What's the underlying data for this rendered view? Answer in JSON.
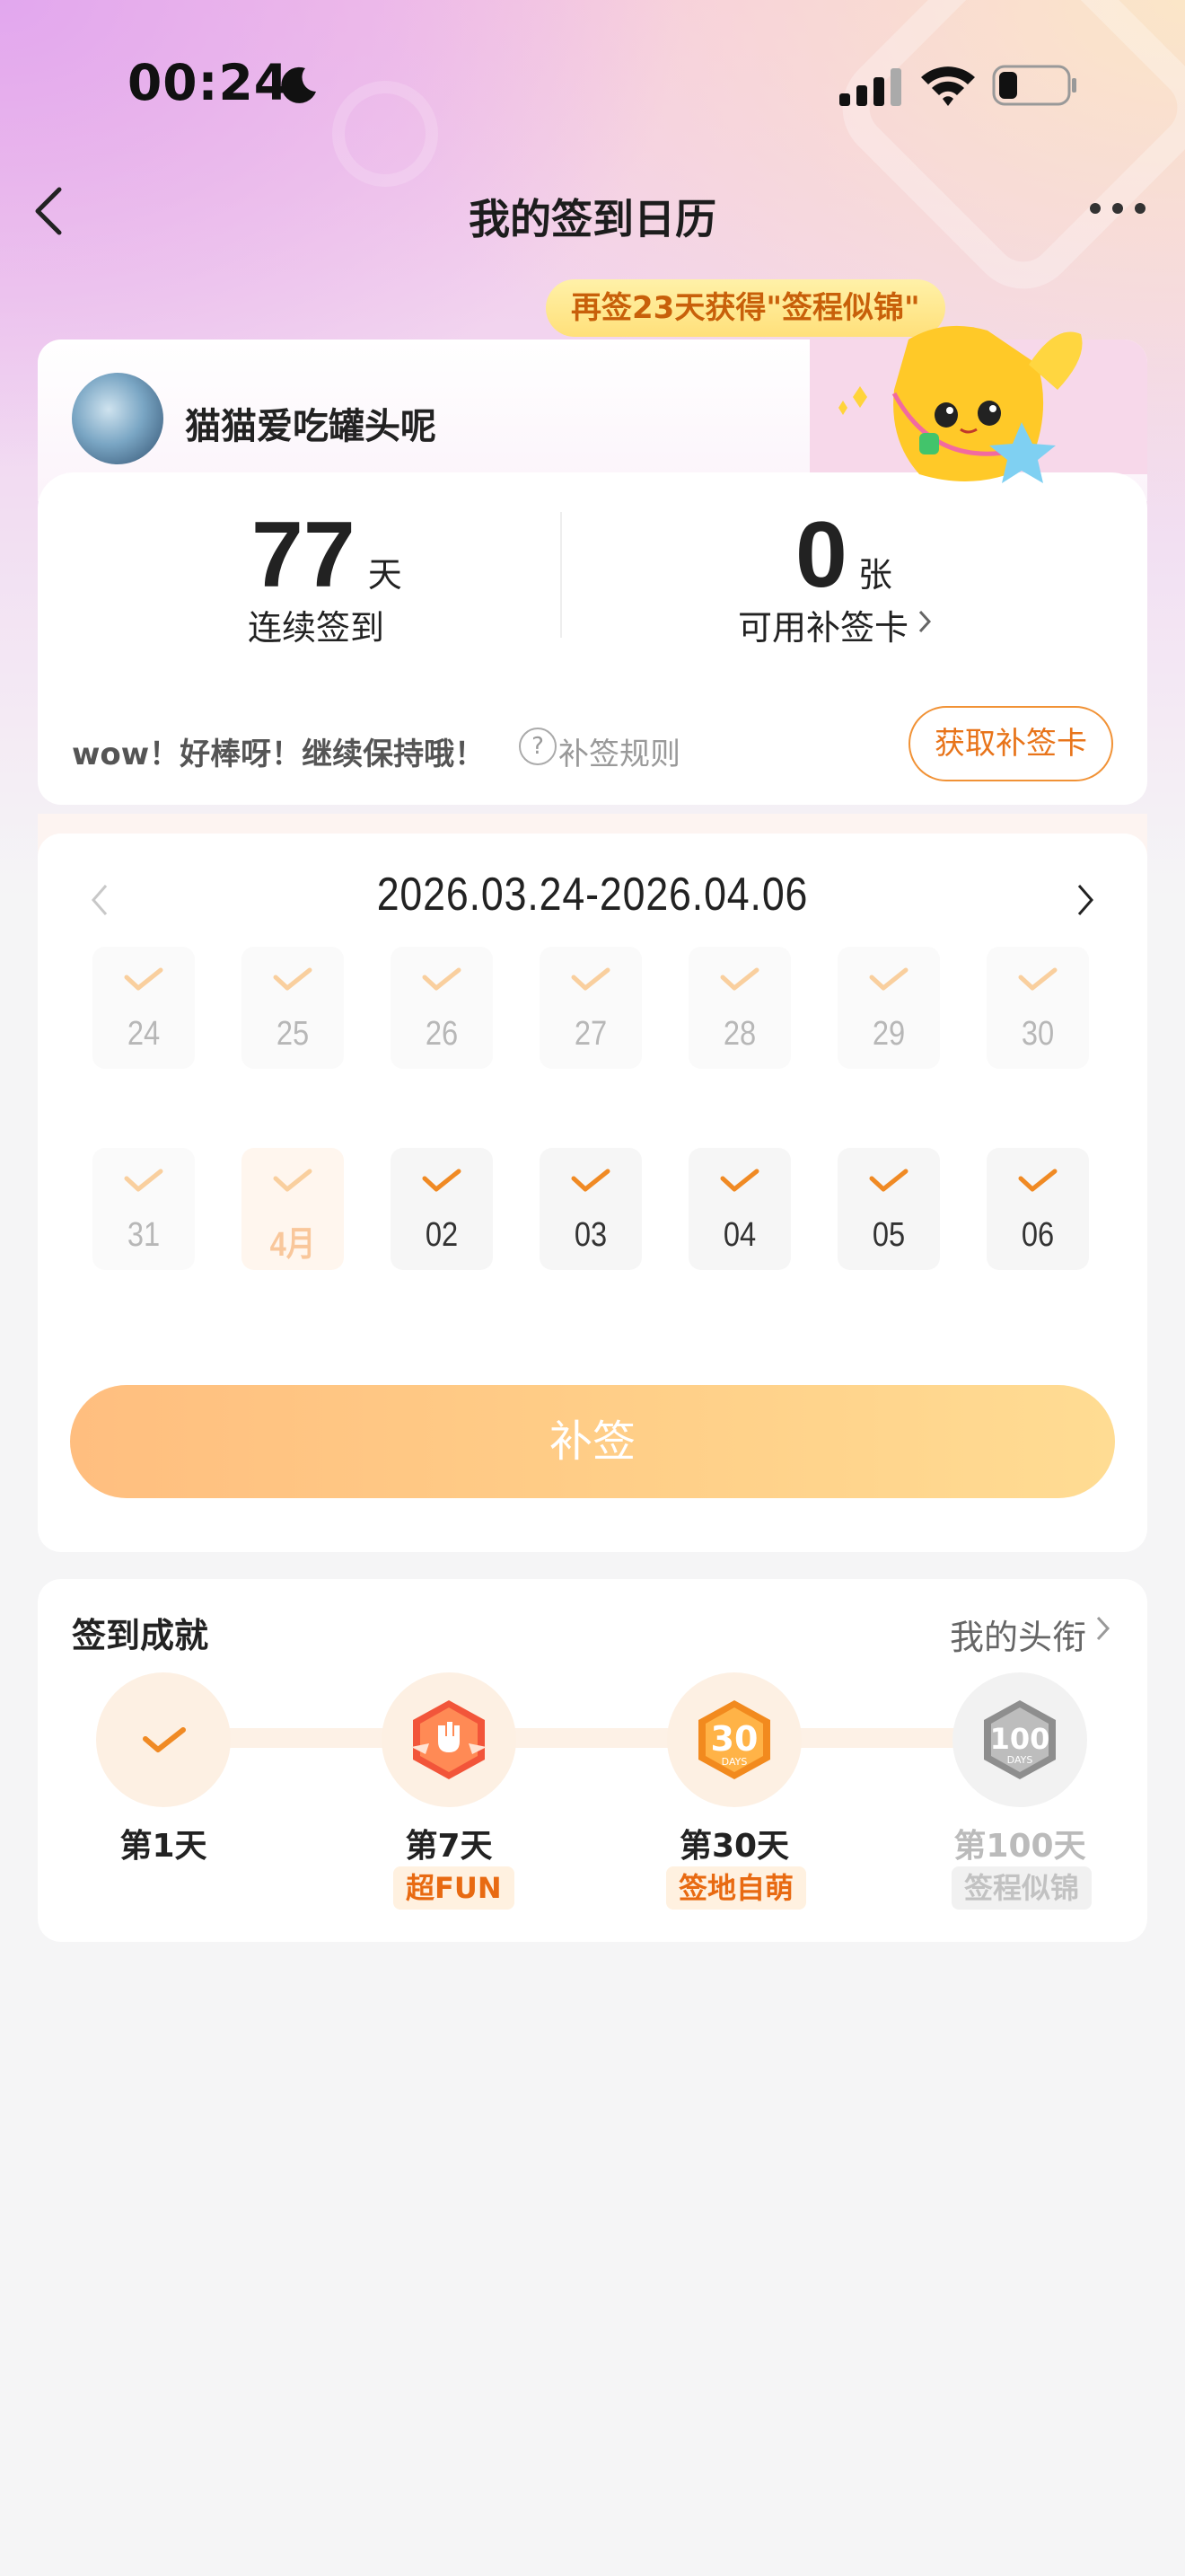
{
  "status_bar": {
    "time": "00:24"
  },
  "nav": {
    "title": "我的签到日历"
  },
  "promo": {
    "text": "再签23天获得\"签程似锦\""
  },
  "user": {
    "name": "猫猫爱吃罐头呢",
    "streak_value": "77",
    "streak_unit": "天",
    "streak_label": "连续签到",
    "cards_value": "0",
    "cards_unit": "张",
    "cards_label": "可用补签卡"
  },
  "tip": {
    "message": "wow！好棒呀！继续保持哦！",
    "rule_link": "补签规则",
    "get_card_button": "获取补签卡"
  },
  "calendar": {
    "range": "2026.03.24-2026.04.06",
    "days": [
      {
        "label": "24",
        "state": "past"
      },
      {
        "label": "25",
        "state": "past"
      },
      {
        "label": "26",
        "state": "past"
      },
      {
        "label": "27",
        "state": "past"
      },
      {
        "label": "28",
        "state": "past"
      },
      {
        "label": "29",
        "state": "past"
      },
      {
        "label": "30",
        "state": "past"
      },
      {
        "label": "31",
        "state": "past"
      },
      {
        "label": "4月",
        "state": "month"
      },
      {
        "label": "02",
        "state": "done"
      },
      {
        "label": "03",
        "state": "done"
      },
      {
        "label": "04",
        "state": "done"
      },
      {
        "label": "05",
        "state": "done"
      },
      {
        "label": "06",
        "state": "done"
      }
    ],
    "resign_button": "补签"
  },
  "achievements": {
    "title": "签到成就",
    "link": "我的头衔",
    "items": [
      {
        "day": "第1天",
        "tag": "",
        "status": "achieved"
      },
      {
        "day": "第7天",
        "tag": "超FUN",
        "status": "achieved"
      },
      {
        "day": "第30天",
        "tag": "签地自萌",
        "status": "achieved"
      },
      {
        "day": "第100天",
        "tag": "签程似锦",
        "status": "locked"
      }
    ]
  },
  "colors": {
    "accent": "#f08a24",
    "check_light": "#f9cf9e",
    "button": "#ffc886"
  }
}
